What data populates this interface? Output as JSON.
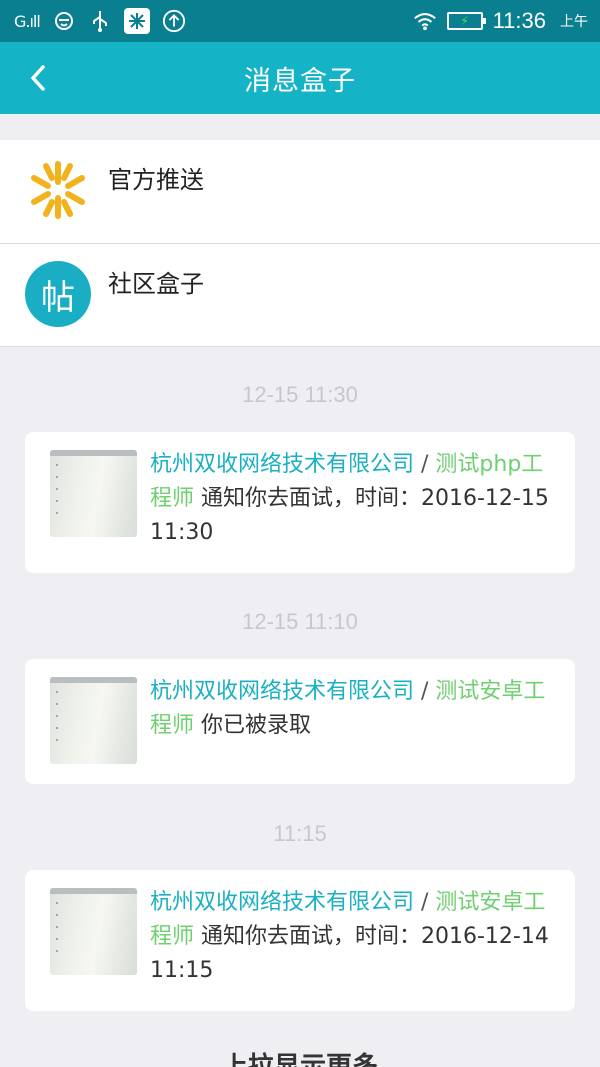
{
  "status_bar": {
    "signal": "G.ıll",
    "time": "11:36",
    "ampm": "上午",
    "icons": [
      "signal-icon",
      "app-icon",
      "usb-icon",
      "snowflake-icon",
      "upload-icon",
      "wifi-icon",
      "battery-icon"
    ]
  },
  "nav": {
    "title": "消息盒子",
    "back_icon": "chevron-left-icon"
  },
  "entries": [
    {
      "label": "官方推送",
      "icon": "official-logo-icon"
    },
    {
      "label": "社区盒子",
      "icon": "post-badge-icon",
      "badge_text": "帖"
    }
  ],
  "messages": [
    {
      "timestamp": "12-15 11:30",
      "company": "杭州双收网络技术有限公司",
      "separator": " / ",
      "job": "测试php工程师",
      "text": " 通知你去面试，时间：2016-12-15 11:30"
    },
    {
      "timestamp": "12-15 11:10",
      "company": "杭州双收网络技术有限公司",
      "separator": " / ",
      "job": "测试安卓工程师",
      "text": " 你已被录取"
    },
    {
      "timestamp": "11:15",
      "company": "杭州双收网络技术有限公司",
      "separator": " / ",
      "job": "测试安卓工程师",
      "text": " 通知你去面试，时间：2016-12-14 11:15"
    }
  ],
  "footer": {
    "pull_more": "上拉显示更多"
  },
  "colors": {
    "status_bar": "#0a7f8f",
    "nav_bar": "#15b3c6",
    "company": "#1ab0c3",
    "job": "#6fd06f",
    "background": "#eeeef3"
  }
}
